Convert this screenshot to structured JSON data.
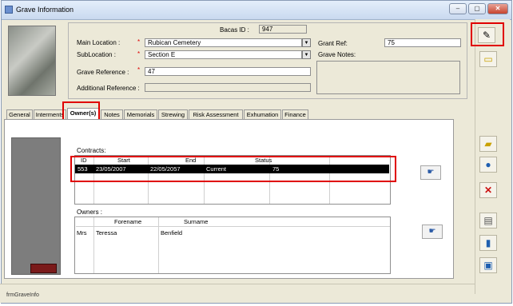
{
  "window": {
    "title": "Grave Information",
    "min_label": "–",
    "max_label": "▢",
    "close_label": "✕"
  },
  "header": {
    "bacas_id_label": "Bacas ID :",
    "bacas_id_value": "947",
    "main_location_label": "Main Location :",
    "main_location_value": "Rubican Cemetery",
    "sublocation_label": "SubLocation :",
    "sublocation_value": "Section E",
    "grave_reference_label": "Grave Reference :",
    "grave_reference_value": "47",
    "additional_reference_label": "Additional Reference :",
    "additional_reference_value": "",
    "grant_ref_label": "Grant Ref:",
    "grant_ref_value": "75",
    "grave_notes_label": "Grave Notes:",
    "required_mark": "*"
  },
  "tabs": [
    "General",
    "Interments",
    "Owner(s)",
    "Notes",
    "Memorials",
    "Strewing",
    "Risk Assessment",
    "Exhumation",
    "Finance"
  ],
  "contracts": {
    "label": "Contracts:",
    "columns": [
      "ID",
      "Start",
      "End",
      "Status"
    ],
    "rows": [
      {
        "id": "553",
        "start": "23/05/2007",
        "end": "22/05/2057",
        "status": "Current",
        "extra": "75"
      }
    ]
  },
  "owners": {
    "label": "Owners :",
    "columns": [
      "Forename",
      "Surname"
    ],
    "rows": [
      {
        "title": "Mrs",
        "forename": "Teressa",
        "surname": "Benfield"
      }
    ]
  },
  "sidebar": {
    "icons": [
      "edit-pen-icon",
      "new-record-icon",
      "open-folder-icon",
      "globe-icon",
      "delete-x-icon",
      "print-icon",
      "exit-door-icon",
      "monitor-icon"
    ]
  },
  "status_bar": {
    "form_name": "frmGraveInfo"
  },
  "colors": {
    "highlight": "#e00000",
    "selection": "#000000"
  }
}
